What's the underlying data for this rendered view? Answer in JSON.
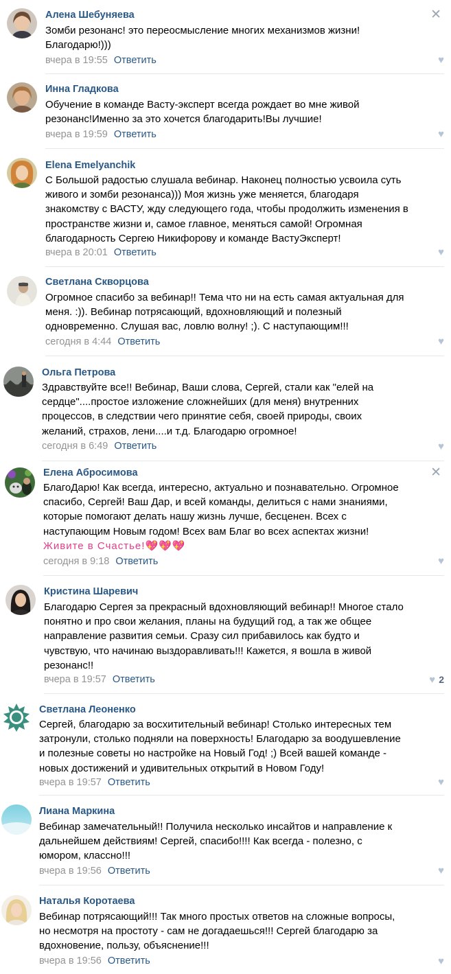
{
  "icons": {
    "like": "heart-icon",
    "close": "close-icon"
  },
  "colors": {
    "link": "#2a5885",
    "meta": "#939393",
    "divider": "#e7e8ec",
    "like": "#b6c5d5"
  },
  "comments": [
    {
      "author": "Алена Шебуняева",
      "text": [
        "Зомби резонанс! это переосмысление многих механизмов жизни!",
        "Благодарю!)))"
      ],
      "time": "вчера в 19:55",
      "reply": "Ответить",
      "likes": ""
    },
    {
      "author": "Инна Гладкова",
      "text": [
        "Обучение в команде Васту-эксперт всегда рождает во мне живой",
        "резонанс!Именно за это хочется благодарить!Вы лучшие!"
      ],
      "time": "вчера в 19:59",
      "reply": "Ответить",
      "likes": ""
    },
    {
      "author": "Elena Emelyanchik",
      "text": [
        "С Большой радостью слушала вебинар. Наконец полностью усвоила суть",
        "живого и зомби резонанса))) Моя жизнь уже меняется, благодаря",
        "знакомству с ВАСТУ, жду следующего года, чтобы продолжить изменения в",
        "пространстве жизни и, самое главное, меняться самой! Огромная",
        "благодарность Сергею Никифорову и команде ВастуЭксперт!"
      ],
      "time": "вчера в 20:01",
      "reply": "Ответить",
      "likes": ""
    },
    {
      "author": "Светлана Скворцова",
      "text": [
        "Огромное спасибо за вебинар!! Тема что ни на есть самая актуальная для",
        "меня. :)). Вебинар потрясающий, вдохновляющий и полезный",
        "одновременно. Слушая вас, ловлю волну! ;). С наступающим!!!"
      ],
      "time": "сегодня в 4:44",
      "reply": "Ответить",
      "likes": ""
    },
    {
      "author": "Ольга Петрова",
      "text": [
        "Здравствуйте все!! Вебинар, Ваши слова, Сергей, стали как \"елей на",
        "сердце\"....простое изложение сложнейших (для меня) внутренних",
        "процессов, в следствии чего принятие себя, своей природы, своих",
        "желаний, страхов, лени....и т.д. Благодарю огромное!"
      ],
      "time": "сегодня в 6:49",
      "reply": "Ответить",
      "likes": ""
    },
    {
      "author": "Елена Абросимова",
      "text": [
        "БлагоДарю! Как всегда, интересно, актуально и познавательно. Огромное",
        "спасибо, Сергей! Ваш Дар, и всей команды, делиться с нами знаниями,",
        "которые помогают делать нашу жизнь лучше, бесценен. Всех с",
        "наступающим Новым годом! Всех вам Благ во всех аспектах жизни!",
        "Живите в Счастье!💖💖💖"
      ],
      "time": "сегодня в 9:18",
      "reply": "Ответить",
      "likes": ""
    },
    {
      "author": "Кристина Шаревич",
      "text": [
        "Благодарю Сергея за прекрасный вдохновляющий вебинар!! Многое стало",
        "понятно и про свои желания, планы на будущий год, а так же общее",
        "направление развития семьи. Сразу сил прибавилось как будто и",
        "чувствую, что начинаю выздоравливать!!! Кажется, я вошла в живой",
        "резонанс!!"
      ],
      "time": "вчера в 19:57",
      "reply": "Ответить",
      "likes": "2"
    },
    {
      "author": "Светлана Леоненко",
      "text": [
        "Сергей, благодарю за восхитительный вебинар! Столько интересных тем",
        "затронули, столько подняли на поверхность! Благодарю за воодушевление",
        "и полезные советы но настройке на Новый Год! ;) Всей вашей команде -",
        "новых достижений и удивительных открытий в Новом Году!"
      ],
      "time": "вчера в 19:57",
      "reply": "Ответить",
      "likes": ""
    },
    {
      "author": "Лиана Маркина",
      "text": [
        "Вебинар замечательный!! Получила несколько инсайтов и направление к",
        "дальнейшем действиям! Сергей, спасибо!!!! Как всегда - полезно, с",
        "юмором, классно!!!"
      ],
      "time": "вчера в 19:56",
      "reply": "Ответить",
      "likes": ""
    },
    {
      "author": "Наталья Коротаева",
      "text": [
        "Вебинар потрясающий!!! Так много простых ответов на сложные вопросы,",
        "но несмотря на простоту - сам не догадаешься!!! Сергей благодарю за",
        "вдохновение, пользу, объяснение!!!"
      ],
      "time": "вчера в 19:56",
      "reply": "Ответить",
      "likes": ""
    }
  ]
}
